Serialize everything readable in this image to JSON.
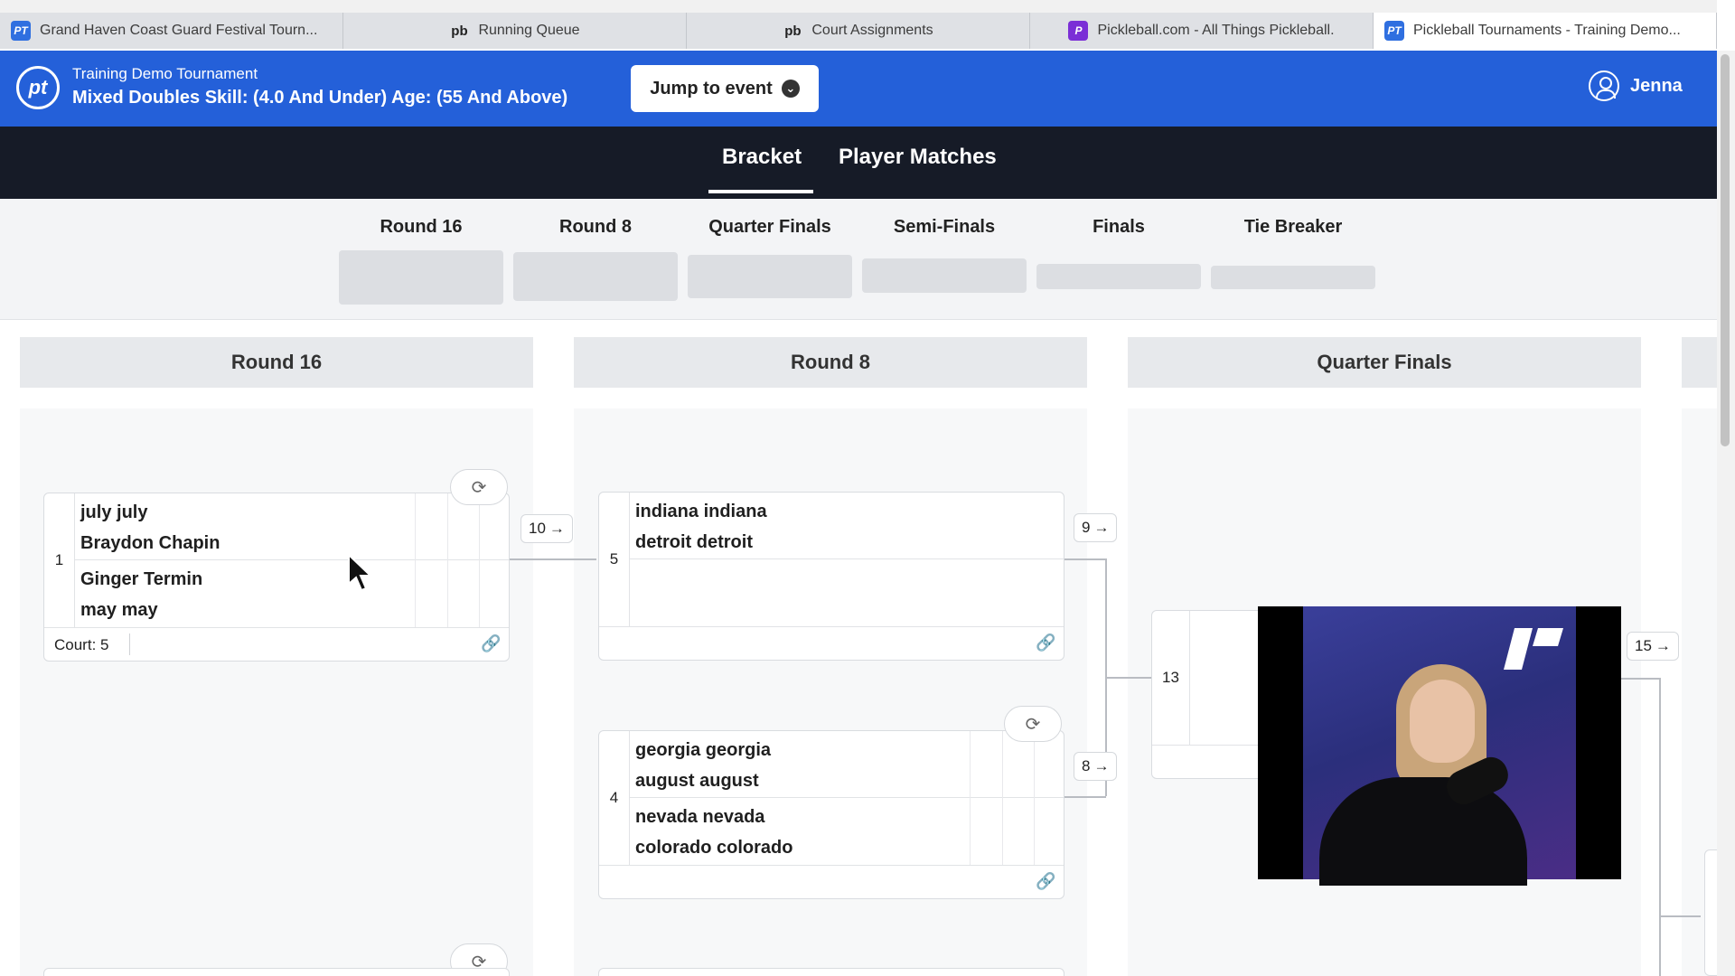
{
  "browser": {
    "tabs": [
      {
        "label": "Grand Haven Coast Guard Festival Tourn...",
        "icon": "pt-favicon"
      },
      {
        "label": "Running Queue",
        "icon": "pb-favicon"
      },
      {
        "label": "Court Assignments",
        "icon": "pb-favicon"
      },
      {
        "label": "Pickleball.com - All Things Pickleball.",
        "icon": "pickleball-favicon"
      },
      {
        "label": "Pickleball Tournaments - Training Demo...",
        "icon": "pt-favicon",
        "active": true
      }
    ]
  },
  "header": {
    "logo": "pt",
    "tournament": "Training Demo Tournament",
    "event": "Mixed Doubles Skill: (4.0 And Under) Age: (55 And Above)",
    "jump_label": "Jump to event",
    "user_name": "Jenna",
    "brand_color": "#2460d9"
  },
  "nav": {
    "tabs": [
      {
        "label": "Bracket",
        "active": true
      },
      {
        "label": "Player Matches",
        "active": false
      }
    ]
  },
  "round_selector": [
    "Round 16",
    "Round 8",
    "Quarter Finals",
    "Semi-Finals",
    "Finals",
    "Tie Breaker"
  ],
  "columns": [
    "Round 16",
    "Round 8",
    "Quarter Finals"
  ],
  "matches": {
    "m1": {
      "number": "1",
      "team1": [
        "july july",
        "Braydon Chapin"
      ],
      "team2": [
        "Ginger Termin",
        "may may"
      ],
      "court": "Court: 5",
      "advance": "10"
    },
    "m5": {
      "number": "5",
      "team1": [
        "indiana indiana",
        "detroit detroit"
      ],
      "advance": "9"
    },
    "m4": {
      "number": "4",
      "team1": [
        "georgia georgia",
        "august august"
      ],
      "team2": [
        "nevada nevada",
        "colorado colorado"
      ],
      "advance": "8"
    },
    "m13": {
      "number": "13",
      "advance": "15"
    }
  },
  "icons": {
    "refresh": "refresh-icon",
    "link": "link-icon",
    "arrow": "arrow-right-icon"
  }
}
